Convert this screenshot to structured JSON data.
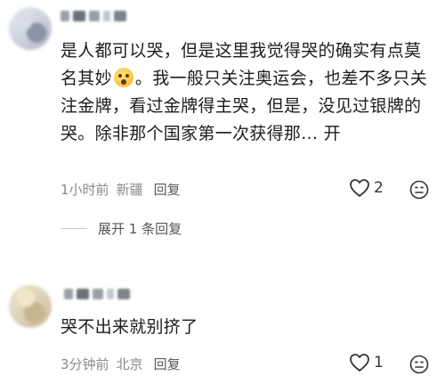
{
  "comments": [
    {
      "text_before_emoji": "是人都可以哭，但是这里我觉得哭的确实有点莫名其妙",
      "text_after_emoji": "。我一般只关注奥运会，也差不多只关注金牌，看过金牌得主哭，但是，没见过银牌的哭。除非那个国家第一次获得那...",
      "emoji_icon": "astonished-face-emoji",
      "expand_inline": "开",
      "time": "1小时前",
      "location": "新疆",
      "reply_label": "回复",
      "likes": "2",
      "replies_expand_label": "展开 1 条回复"
    },
    {
      "text": "哭不出来就别挤了",
      "time": "3分钟前",
      "location": "北京",
      "reply_label": "回复",
      "likes": "1"
    }
  ],
  "icons": {
    "like": "heart-icon",
    "emoji_reply": "smiley-face-icon"
  },
  "colors": {
    "text": "#1c1c1c",
    "meta": "#8a8a8a",
    "background": "#ffffff"
  }
}
